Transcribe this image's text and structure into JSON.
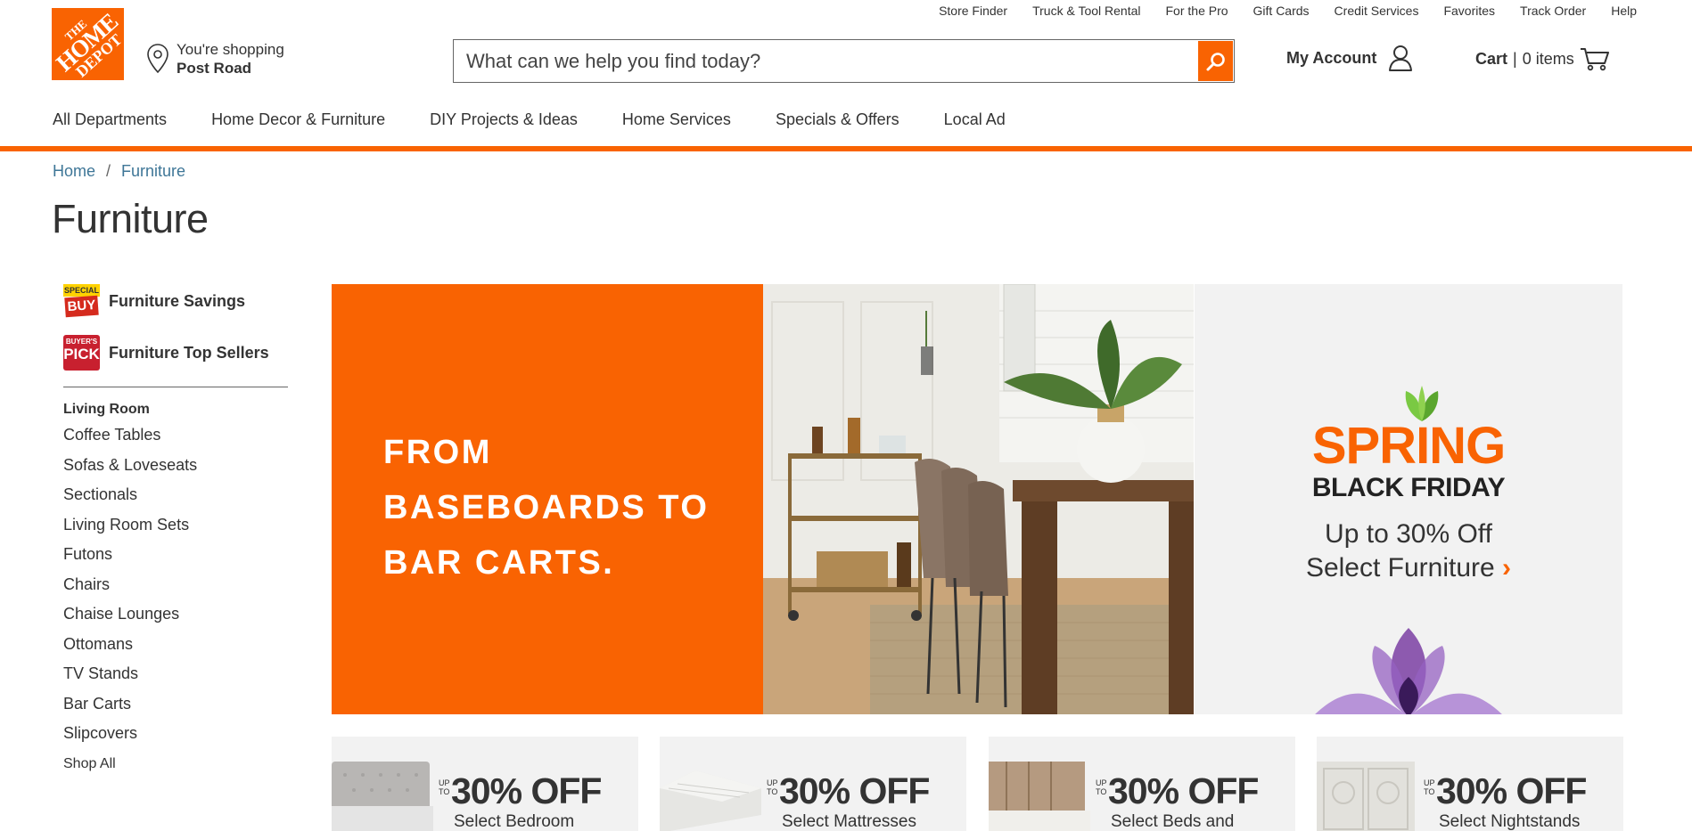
{
  "header": {
    "utility_links": [
      "Store Finder",
      "Truck & Tool Rental",
      "For the Pro",
      "Gift Cards",
      "Credit Services",
      "Favorites",
      "Track Order",
      "Help"
    ],
    "logo": {
      "line1": "THE",
      "line2": "HOME",
      "line3": "DEPOT"
    },
    "store": {
      "label": "You're shopping",
      "name": "Post Road"
    },
    "search": {
      "placeholder": "What can we help you find today?"
    },
    "account_label": "My Account",
    "cart": {
      "label": "Cart",
      "separator": "|",
      "count": "0 items"
    },
    "main_nav": [
      "All Departments",
      "Home Decor & Furniture",
      "DIY Projects & Ideas",
      "Home Services",
      "Specials & Offers",
      "Local Ad"
    ],
    "accent_color": "#f96302"
  },
  "breadcrumb": {
    "home": "Home",
    "separator": "/",
    "current": "Furniture"
  },
  "page_title": "Furniture",
  "sidebar": {
    "promos": [
      {
        "label": "Furniture Savings",
        "badge_top": "SPECIAL",
        "badge_bottom": "BUY"
      },
      {
        "label": "Furniture Top Sellers",
        "badge_top": "BUYER'S",
        "badge_bottom": "PICK"
      }
    ],
    "category_heading": "Living Room",
    "categories": [
      "Coffee Tables",
      "Sofas & Loveseats",
      "Sectionals",
      "Living Room Sets",
      "Futons",
      "Chairs",
      "Chaise Lounges",
      "Ottomans",
      "TV Stands",
      "Bar Carts",
      "Slipcovers"
    ],
    "shop_all": "Shop All"
  },
  "hero": {
    "headline": [
      "FROM",
      "BASEBOARDS TO",
      "BAR CARTS."
    ],
    "promo": {
      "title": "SPRING",
      "subtitle": "BLACK FRIDAY",
      "offer_line1": "Up to 30% Off",
      "offer_line2": "Select Furniture",
      "chevron": "›"
    }
  },
  "deals": [
    {
      "upto": "UP TO",
      "percent": "30% OFF",
      "label": "Select Bedroom"
    },
    {
      "upto": "UP TO",
      "percent": "30% OFF",
      "label": "Select Mattresses"
    },
    {
      "upto": "UP TO",
      "percent": "30% OFF",
      "label": "Select Beds and"
    },
    {
      "upto": "UP TO",
      "percent": "30% OFF",
      "label": "Select Nightstands"
    }
  ]
}
